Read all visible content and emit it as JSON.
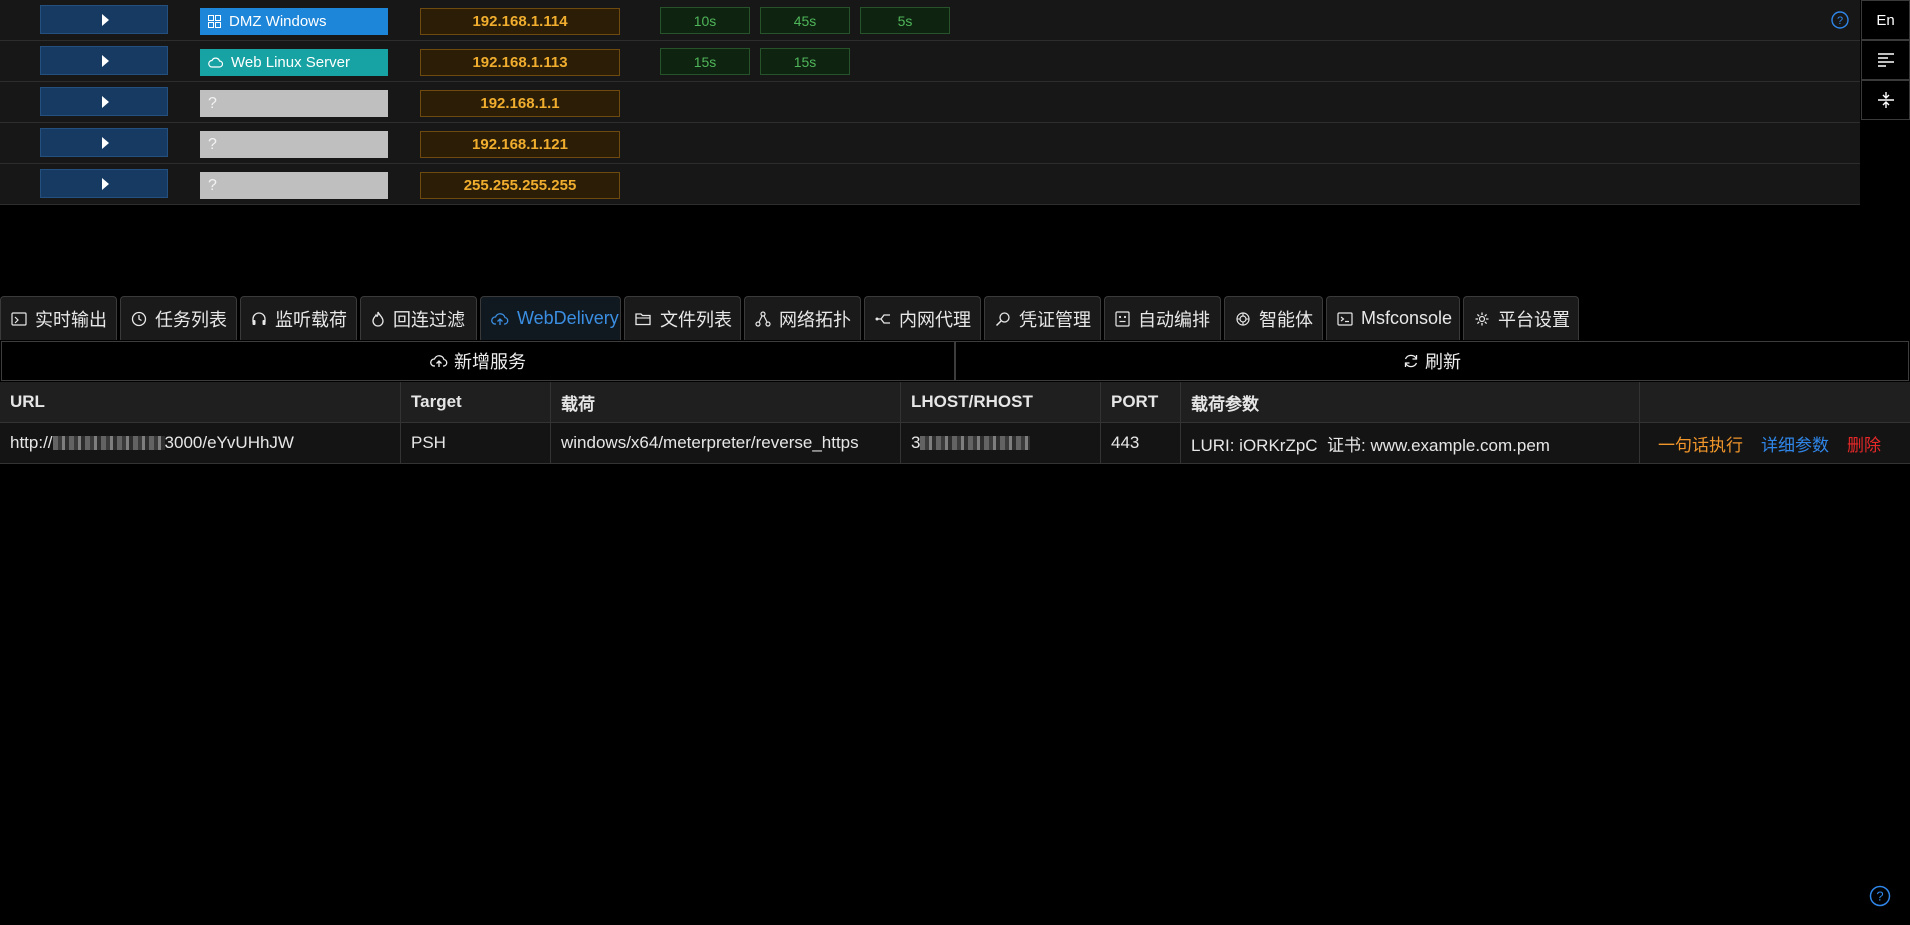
{
  "hosts": [
    {
      "name": "DMZ Windows",
      "icon": "windows-icon",
      "ip": "192.168.1.114",
      "tags": [
        "10s",
        "45s",
        "5s"
      ]
    },
    {
      "name": "Web Linux Server",
      "icon": "cloud-icon",
      "ip": "192.168.1.113",
      "tags": [
        "15s",
        "15s"
      ]
    },
    {
      "name": "?",
      "icon": "",
      "ip": "192.168.1.1",
      "tags": []
    },
    {
      "name": "?",
      "icon": "",
      "ip": "192.168.1.121",
      "tags": []
    },
    {
      "name": "?",
      "icon": "",
      "ip": "255.255.255.255",
      "tags": []
    }
  ],
  "sidebar": {
    "lang": "En"
  },
  "tabs": [
    {
      "label": "实时输出",
      "icon": "output-icon"
    },
    {
      "label": "任务列表",
      "icon": "clock-icon"
    },
    {
      "label": "监听载荷",
      "icon": "headphones-icon"
    },
    {
      "label": "回连过滤",
      "icon": "flame-icon"
    },
    {
      "label": "WebDelivery",
      "icon": "cloud-upload-icon",
      "active": true
    },
    {
      "label": "文件列表",
      "icon": "folder-icon"
    },
    {
      "label": "网络拓扑",
      "icon": "topology-icon"
    },
    {
      "label": "内网代理",
      "icon": "proxy-icon"
    },
    {
      "label": "凭证管理",
      "icon": "key-search-icon"
    },
    {
      "label": "自动编排",
      "icon": "robot-icon"
    },
    {
      "label": "智能体",
      "icon": "ai-icon"
    },
    {
      "label": "Msfconsole",
      "icon": "terminal-icon"
    },
    {
      "label": "平台设置",
      "icon": "gear-icon"
    }
  ],
  "actions": {
    "add_service": "新增服务",
    "refresh": "刷新"
  },
  "table": {
    "headers": [
      "URL",
      "Target",
      "载荷",
      "LHOST/RHOST",
      "PORT",
      "载荷参数",
      ""
    ],
    "rows": [
      {
        "url_prefix": "http://",
        "url_suffix": "3000/eYvUHhJW",
        "target": "PSH",
        "payload": "windows/x64/meterpreter/reverse_https",
        "lhost_prefix": "3",
        "port": "443",
        "params": "LURI: iORKrZpC  证书: www.example.com.pem",
        "ops": {
          "exec": "一句话执行",
          "detail": "详细参数",
          "delete": "删除"
        }
      }
    ]
  },
  "colors": {
    "accent": "#3b8fe2",
    "ip_text": "#f0ad2e",
    "tag_text": "#4fb55a",
    "exec": "#f0952a",
    "delete": "#e62828"
  }
}
